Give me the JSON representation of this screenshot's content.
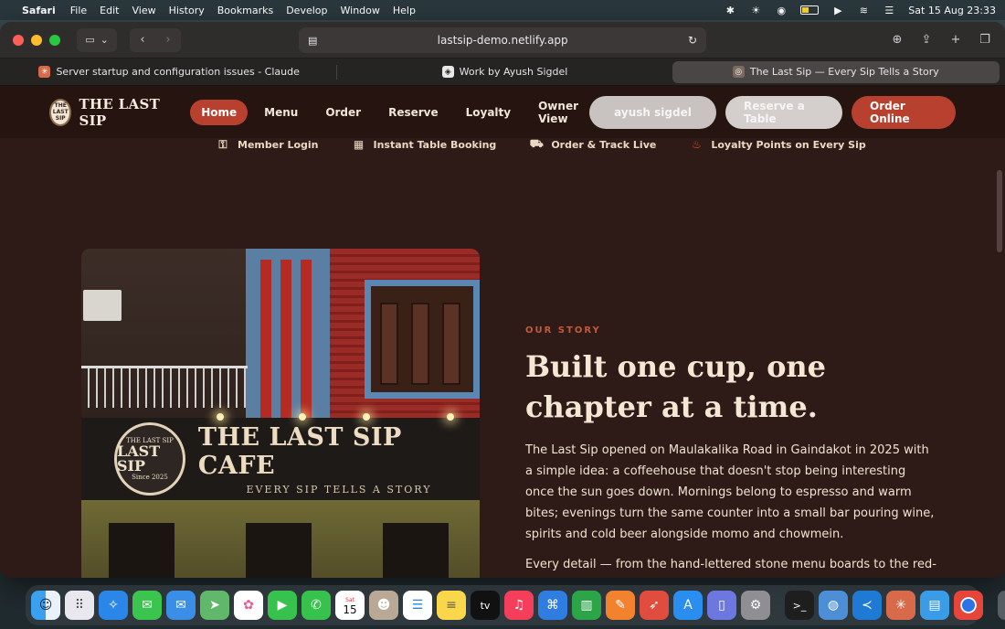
{
  "menubar": {
    "app": "Safari",
    "items": [
      "File",
      "Edit",
      "View",
      "History",
      "Bookmarks",
      "Develop",
      "Window",
      "Help"
    ],
    "datetime": "Sat 15 Aug  23:33"
  },
  "browser": {
    "url": "lastsip-demo.netlify.app",
    "tabs": [
      {
        "title": "Server startup and configuration issues - Claude",
        "active": false
      },
      {
        "title": "Work by Ayush Sigdel",
        "active": false
      },
      {
        "title": "The Last Sip — Every Sip Tells a Story",
        "active": true
      }
    ]
  },
  "site": {
    "brand": "THE LAST SIP",
    "logo_text": "THE LAST SIP",
    "nav": [
      "Home",
      "Menu",
      "Order",
      "Reserve",
      "Loyalty",
      "Owner View"
    ],
    "actions": {
      "user": "ayush sigdel",
      "reserve": "Reserve a Table",
      "order": "Order Online"
    },
    "features": [
      {
        "icon": "key-icon",
        "label": "Member Login"
      },
      {
        "icon": "calendar-icon",
        "label": "Instant Table Booking"
      },
      {
        "icon": "delivery-scooter-icon",
        "label": "Order & Track Live"
      },
      {
        "icon": "fire-icon",
        "label": "Loyalty Points on Every Sip"
      }
    ],
    "hero_sign": {
      "badge_top": "THE LAST SIP",
      "badge_mid": "LAST SIP",
      "badge_bottom": "Since 2025",
      "title": "THE LAST SIP CAFE",
      "subtitle": "EVERY SIP TELLS A STORY"
    },
    "story": {
      "eyebrow": "OUR STORY",
      "title": "Built one cup, one chapter at a time.",
      "body": "The Last Sip opened on Maulakalika Road in Gaindakot in 2025 with a simple idea: a coffeehouse that doesn't stop being interesting once the sun goes down. Mornings belong to espresso and warm bites; evenings turn the same counter into a small bar pouring wine, spirits and cold beer alongside momo and chowmein.",
      "body2": "Every detail — from the hand-lettered stone menu boards to the red-"
    }
  },
  "dock": [
    "Finder",
    "Launchpad",
    "Safari",
    "Messages",
    "Mail",
    "Maps",
    "Photos",
    "FaceTime",
    "Phone",
    "Calendar",
    "Contacts",
    "Reminders",
    "Notes",
    "TV",
    "Music",
    "Keynote",
    "Numbers",
    "Pages",
    "Rocket",
    "App Store",
    "iPhone Mirroring",
    "System Settings",
    "Terminal",
    "Disk",
    "VS Code",
    "Claude",
    "Files",
    "Chrome",
    "Trash"
  ],
  "calendar_day": "15",
  "calendar_month": "Sat"
}
